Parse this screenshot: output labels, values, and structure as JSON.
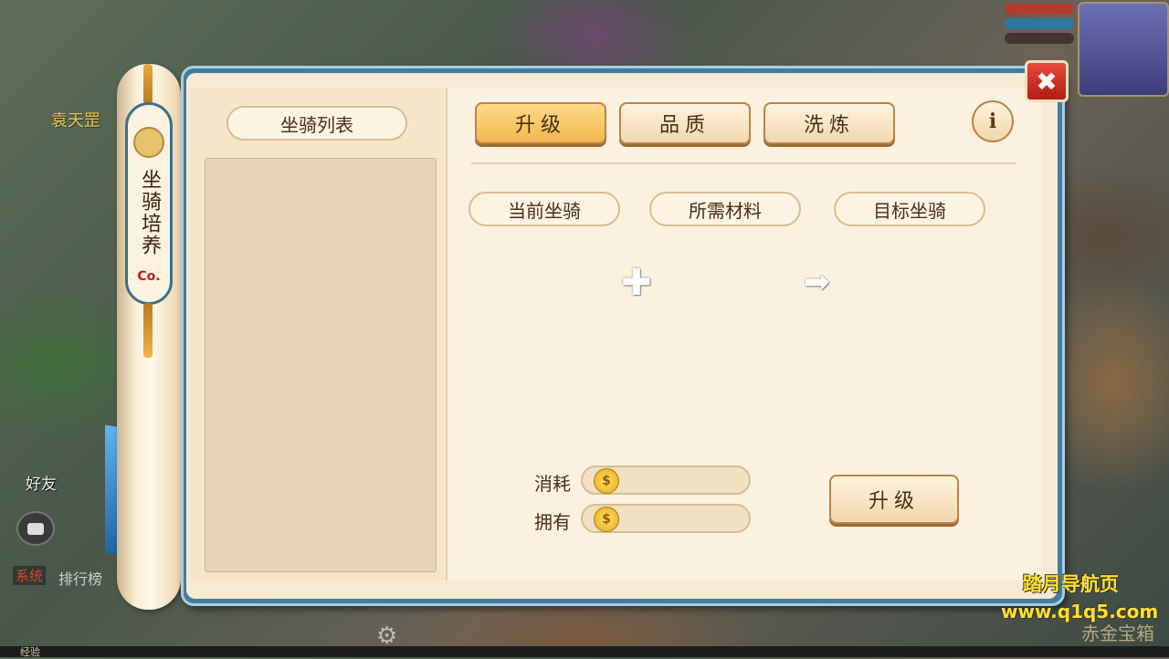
{
  "scene": {
    "npc_name": "袁天罡",
    "friends_label": "好友",
    "system_tag": "系统",
    "ranking_text": "排行榜",
    "exp_label": "经验",
    "watermark_line1": "踏月导航页",
    "watermark_line2": "www.q1q5.com",
    "chest_text": "赤金宝箱"
  },
  "scroll": {
    "title": "坐骑培养",
    "logo": "Co."
  },
  "panel": {
    "list_title": "坐骑列表",
    "tabs": [
      {
        "label": "升级",
        "active": true
      },
      {
        "label": "品质",
        "active": false
      },
      {
        "label": "洗炼",
        "active": false
      }
    ],
    "info_icon": "i",
    "close_icon": "✖",
    "sections": {
      "current": "当前坐骑",
      "materials": "所需材料",
      "target": "目标坐骑"
    },
    "cost_label": "消耗",
    "own_label": "拥有",
    "cost_value": "",
    "own_value": "",
    "upgrade_button": "升级"
  },
  "colors": {
    "accent": "#f1b74f",
    "panel_frame": "#3f7ea0",
    "close_red": "#c9261b",
    "parchment": "#fbf1df"
  },
  "icons": [
    "plus-icon",
    "arrow-right-icon",
    "gold-coin-icon",
    "info-icon",
    "close-icon",
    "gear-icon",
    "chat-icon"
  ]
}
